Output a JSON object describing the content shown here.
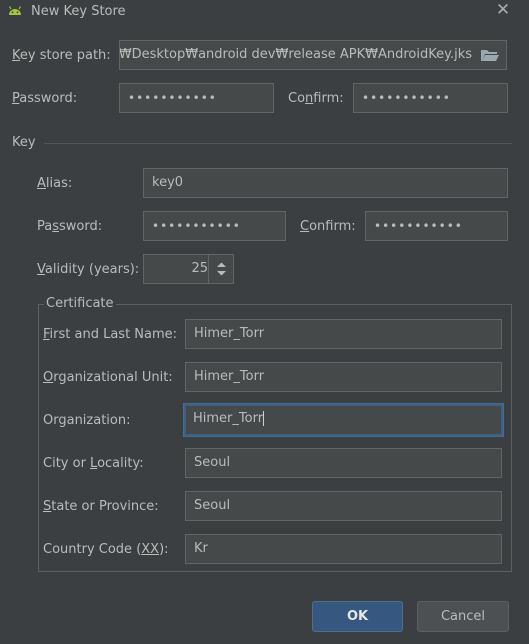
{
  "window": {
    "title": "New Key Store"
  },
  "keystore": {
    "path_label_pre": "",
    "path_label_u": "K",
    "path_label_post": "ey store path:",
    "path_value": "oin₩Desktop₩android dev₩release APK₩AndroidKey.jks",
    "password_label_pre": "",
    "password_label_u": "P",
    "password_label_post": "assword:",
    "password_value": "•••••••••••",
    "confirm_label_pre": "Co",
    "confirm_label_u": "n",
    "confirm_label_post": "firm:",
    "confirm_value": "•••••••••••"
  },
  "key": {
    "section_label": "Key",
    "alias_label_pre": "",
    "alias_label_u": "A",
    "alias_label_post": "lias:",
    "alias_value": "key0",
    "password_label_pre": "Pa",
    "password_label_u": "s",
    "password_label_post": "sword:",
    "password_value": "•••••••••••",
    "confirm_label_pre": "",
    "confirm_label_u": "C",
    "confirm_label_post": "onfirm:",
    "confirm_value": "•••••••••••",
    "validity_label_pre": "",
    "validity_label_u": "V",
    "validity_label_post": "alidity (years):",
    "validity_value": "25"
  },
  "certificate": {
    "legend": "Certificate",
    "first_last_label_pre": "",
    "first_last_label_u": "F",
    "first_last_label_post": "irst and Last Name:",
    "first_last_value": "Himer_Torr",
    "org_unit_label_pre": "",
    "org_unit_label_u": "O",
    "org_unit_label_post": "rganizational Unit:",
    "org_unit_value": "Himer_Torr",
    "org_label": "Organization:",
    "org_value": "Himer_Torr",
    "city_label_pre": "City or ",
    "city_label_u": "L",
    "city_label_post": "ocality:",
    "city_value": "Seoul",
    "state_label_pre": "",
    "state_label_u": "S",
    "state_label_post": "tate or Province:",
    "state_value": "Seoul",
    "country_label_pre": "Country Code (",
    "country_label_u": "XX",
    "country_label_post": "):",
    "country_value": "Kr"
  },
  "buttons": {
    "ok": "OK",
    "cancel": "Cancel"
  },
  "colors": {
    "accent": "#365880",
    "focus_border": "#3d6185",
    "background": "#3c3f41",
    "field": "#45494a",
    "android_green": "#a4c639"
  }
}
